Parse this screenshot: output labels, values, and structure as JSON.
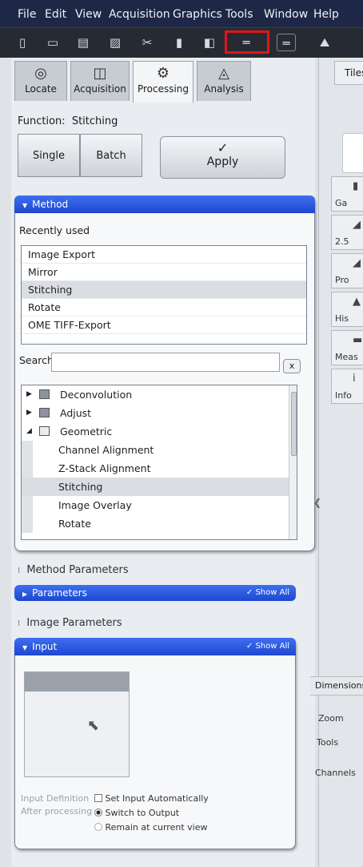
{
  "menu": [
    "File",
    "Edit",
    "View",
    "Acquisition",
    "Graphics",
    "Tools",
    "Window",
    "Help"
  ],
  "toolbar": {
    "icons": [
      "new-icon",
      "open-icon",
      "save-icon",
      "save-as-icon",
      "close-icon",
      "copy-icon",
      "paste-icon",
      "ruler-icon",
      "ruler-alt-icon",
      "image-icon"
    ],
    "glyphs": [
      "▯",
      "▭",
      "▤",
      "▨",
      "✂",
      "▮",
      "◧",
      "═",
      "═",
      "⛰"
    ],
    "highlight_color": "#e0161a"
  },
  "tabs": [
    {
      "label": "Locate",
      "icon": "microscope-icon",
      "glyph": "◎"
    },
    {
      "label": "Acquisition",
      "icon": "camera-icon",
      "glyph": "◫"
    },
    {
      "label": "Processing",
      "icon": "gear-icon",
      "glyph": "⚙"
    },
    {
      "label": "Analysis",
      "icon": "chart-icon",
      "glyph": "◬"
    }
  ],
  "right_panel": {
    "tab_label": "Tiles",
    "side_tabs": [
      {
        "label": "Ga",
        "glyph": "▮"
      },
      {
        "label": "2.5",
        "glyph": "◢"
      },
      {
        "label": "Pro",
        "glyph": "◢"
      },
      {
        "label": "His",
        "glyph": "▲"
      },
      {
        "label": "Meas",
        "glyph": "▬"
      },
      {
        "label": "Info",
        "glyph": "i"
      }
    ],
    "dimensions_label": "Dimensions",
    "zoom_label": "Zoom",
    "tools_label": "Tools",
    "channels_label": "Channels"
  },
  "function": {
    "label": "Function:",
    "value": "Stitching",
    "single_label": "Single",
    "batch_label": "Batch",
    "apply_label": "Apply",
    "apply_glyph": "✓"
  },
  "method": {
    "header": "Method",
    "recently_used_label": "Recently used",
    "recent": [
      "Image Export",
      "Mirror",
      "Stitching",
      "Rotate",
      "OME TIFF-Export"
    ],
    "recent_selected": 2,
    "search_label": "Search",
    "search_value": "",
    "clear_label": "x",
    "tree": [
      {
        "label": "Deconvolution",
        "level": 0,
        "expander": "▶"
      },
      {
        "label": "Adjust",
        "level": 0,
        "expander": "▶"
      },
      {
        "label": "Geometric",
        "level": 0,
        "expander": "◢"
      },
      {
        "label": "Channel Alignment",
        "level": 1
      },
      {
        "label": "Z-Stack Alignment",
        "level": 1
      },
      {
        "label": "Stitching",
        "level": 1,
        "selected": true
      },
      {
        "label": "Image Overlay",
        "level": 1
      },
      {
        "label": "Rotate",
        "level": 1
      }
    ]
  },
  "method_parameters": {
    "label": "Method Parameters",
    "parameters_header": "Parameters",
    "show_all_label": "Show All"
  },
  "image_parameters": {
    "label": "Image Parameters",
    "input_header": "Input",
    "show_all_label": "Show All",
    "input_definition_label": "Input Definition",
    "set_input_automatically_label": "Set Input Automatically",
    "after_processing_label": "After processing",
    "switch_to_output_label": "Switch to Output",
    "remain_label": "Remain at current view"
  },
  "colors": {
    "menubar": "#1e2846",
    "header_blue": "#2452db",
    "highlight": "#e0161a"
  }
}
